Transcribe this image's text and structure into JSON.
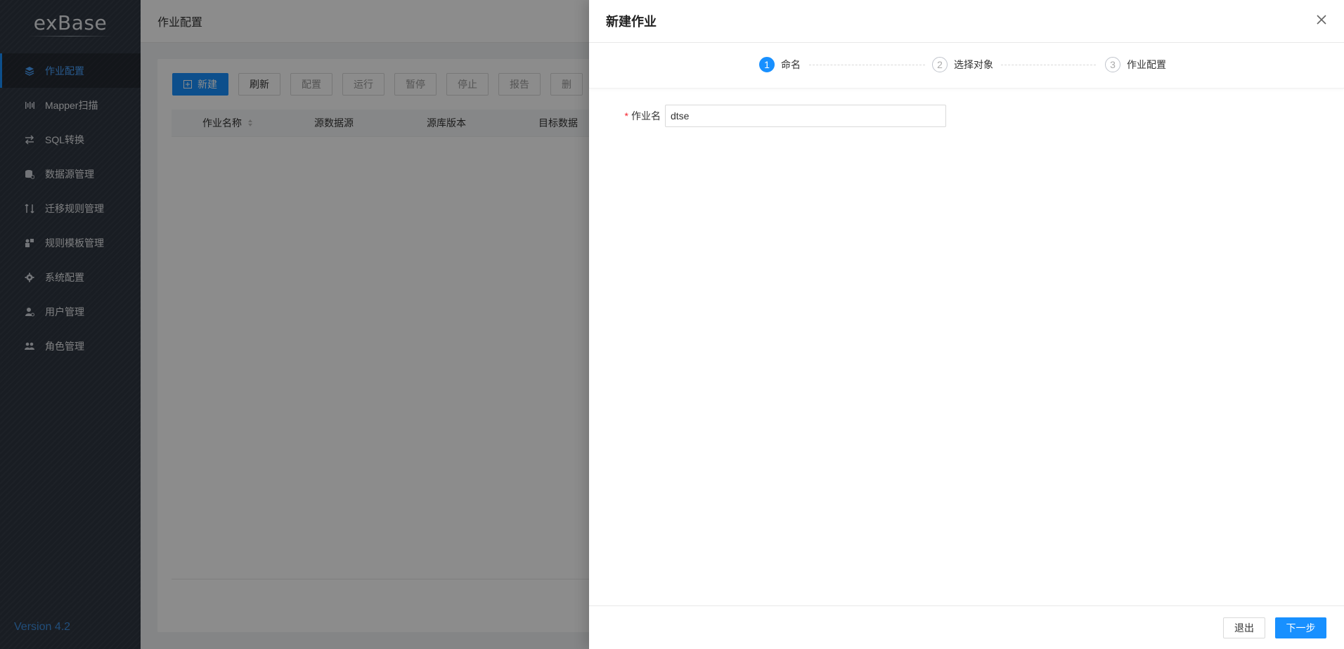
{
  "app": {
    "logo": "exBase",
    "version": "Version 4.2"
  },
  "sidebar": {
    "items": [
      {
        "label": "作业配置",
        "icon": "layers-icon",
        "active": true
      },
      {
        "label": "Mapper扫描",
        "icon": "scan-icon"
      },
      {
        "label": "SQL转换",
        "icon": "swap-icon"
      },
      {
        "label": "数据源管理",
        "icon": "database-icon"
      },
      {
        "label": "迁移规则管理",
        "icon": "migrate-icon"
      },
      {
        "label": "规则模板管理",
        "icon": "template-icon"
      },
      {
        "label": "系统配置",
        "icon": "gear-icon"
      },
      {
        "label": "用户管理",
        "icon": "user-icon"
      },
      {
        "label": "角色管理",
        "icon": "team-icon"
      }
    ]
  },
  "main": {
    "title": "作业配置",
    "toolbar": {
      "new": "新建",
      "refresh": "刷新",
      "config": "配置",
      "run": "运行",
      "pause": "暂停",
      "stop": "停止",
      "report": "报告",
      "more": "删"
    },
    "table": {
      "columns": [
        "作业名称",
        "源数据源",
        "源库版本",
        "目标数据"
      ]
    }
  },
  "drawer": {
    "title": "新建作业",
    "steps": [
      {
        "num": "1",
        "label": "命名",
        "active": true
      },
      {
        "num": "2",
        "label": "选择对象"
      },
      {
        "num": "3",
        "label": "作业配置"
      }
    ],
    "form": {
      "required_mark": "*",
      "job_name_label": "作业名",
      "job_name_value": "dtse"
    },
    "footer": {
      "exit": "退出",
      "next": "下一步"
    }
  },
  "colors": {
    "primary": "#1890ff",
    "sidebar_bg": "#2f3640",
    "required": "#f5222d"
  }
}
